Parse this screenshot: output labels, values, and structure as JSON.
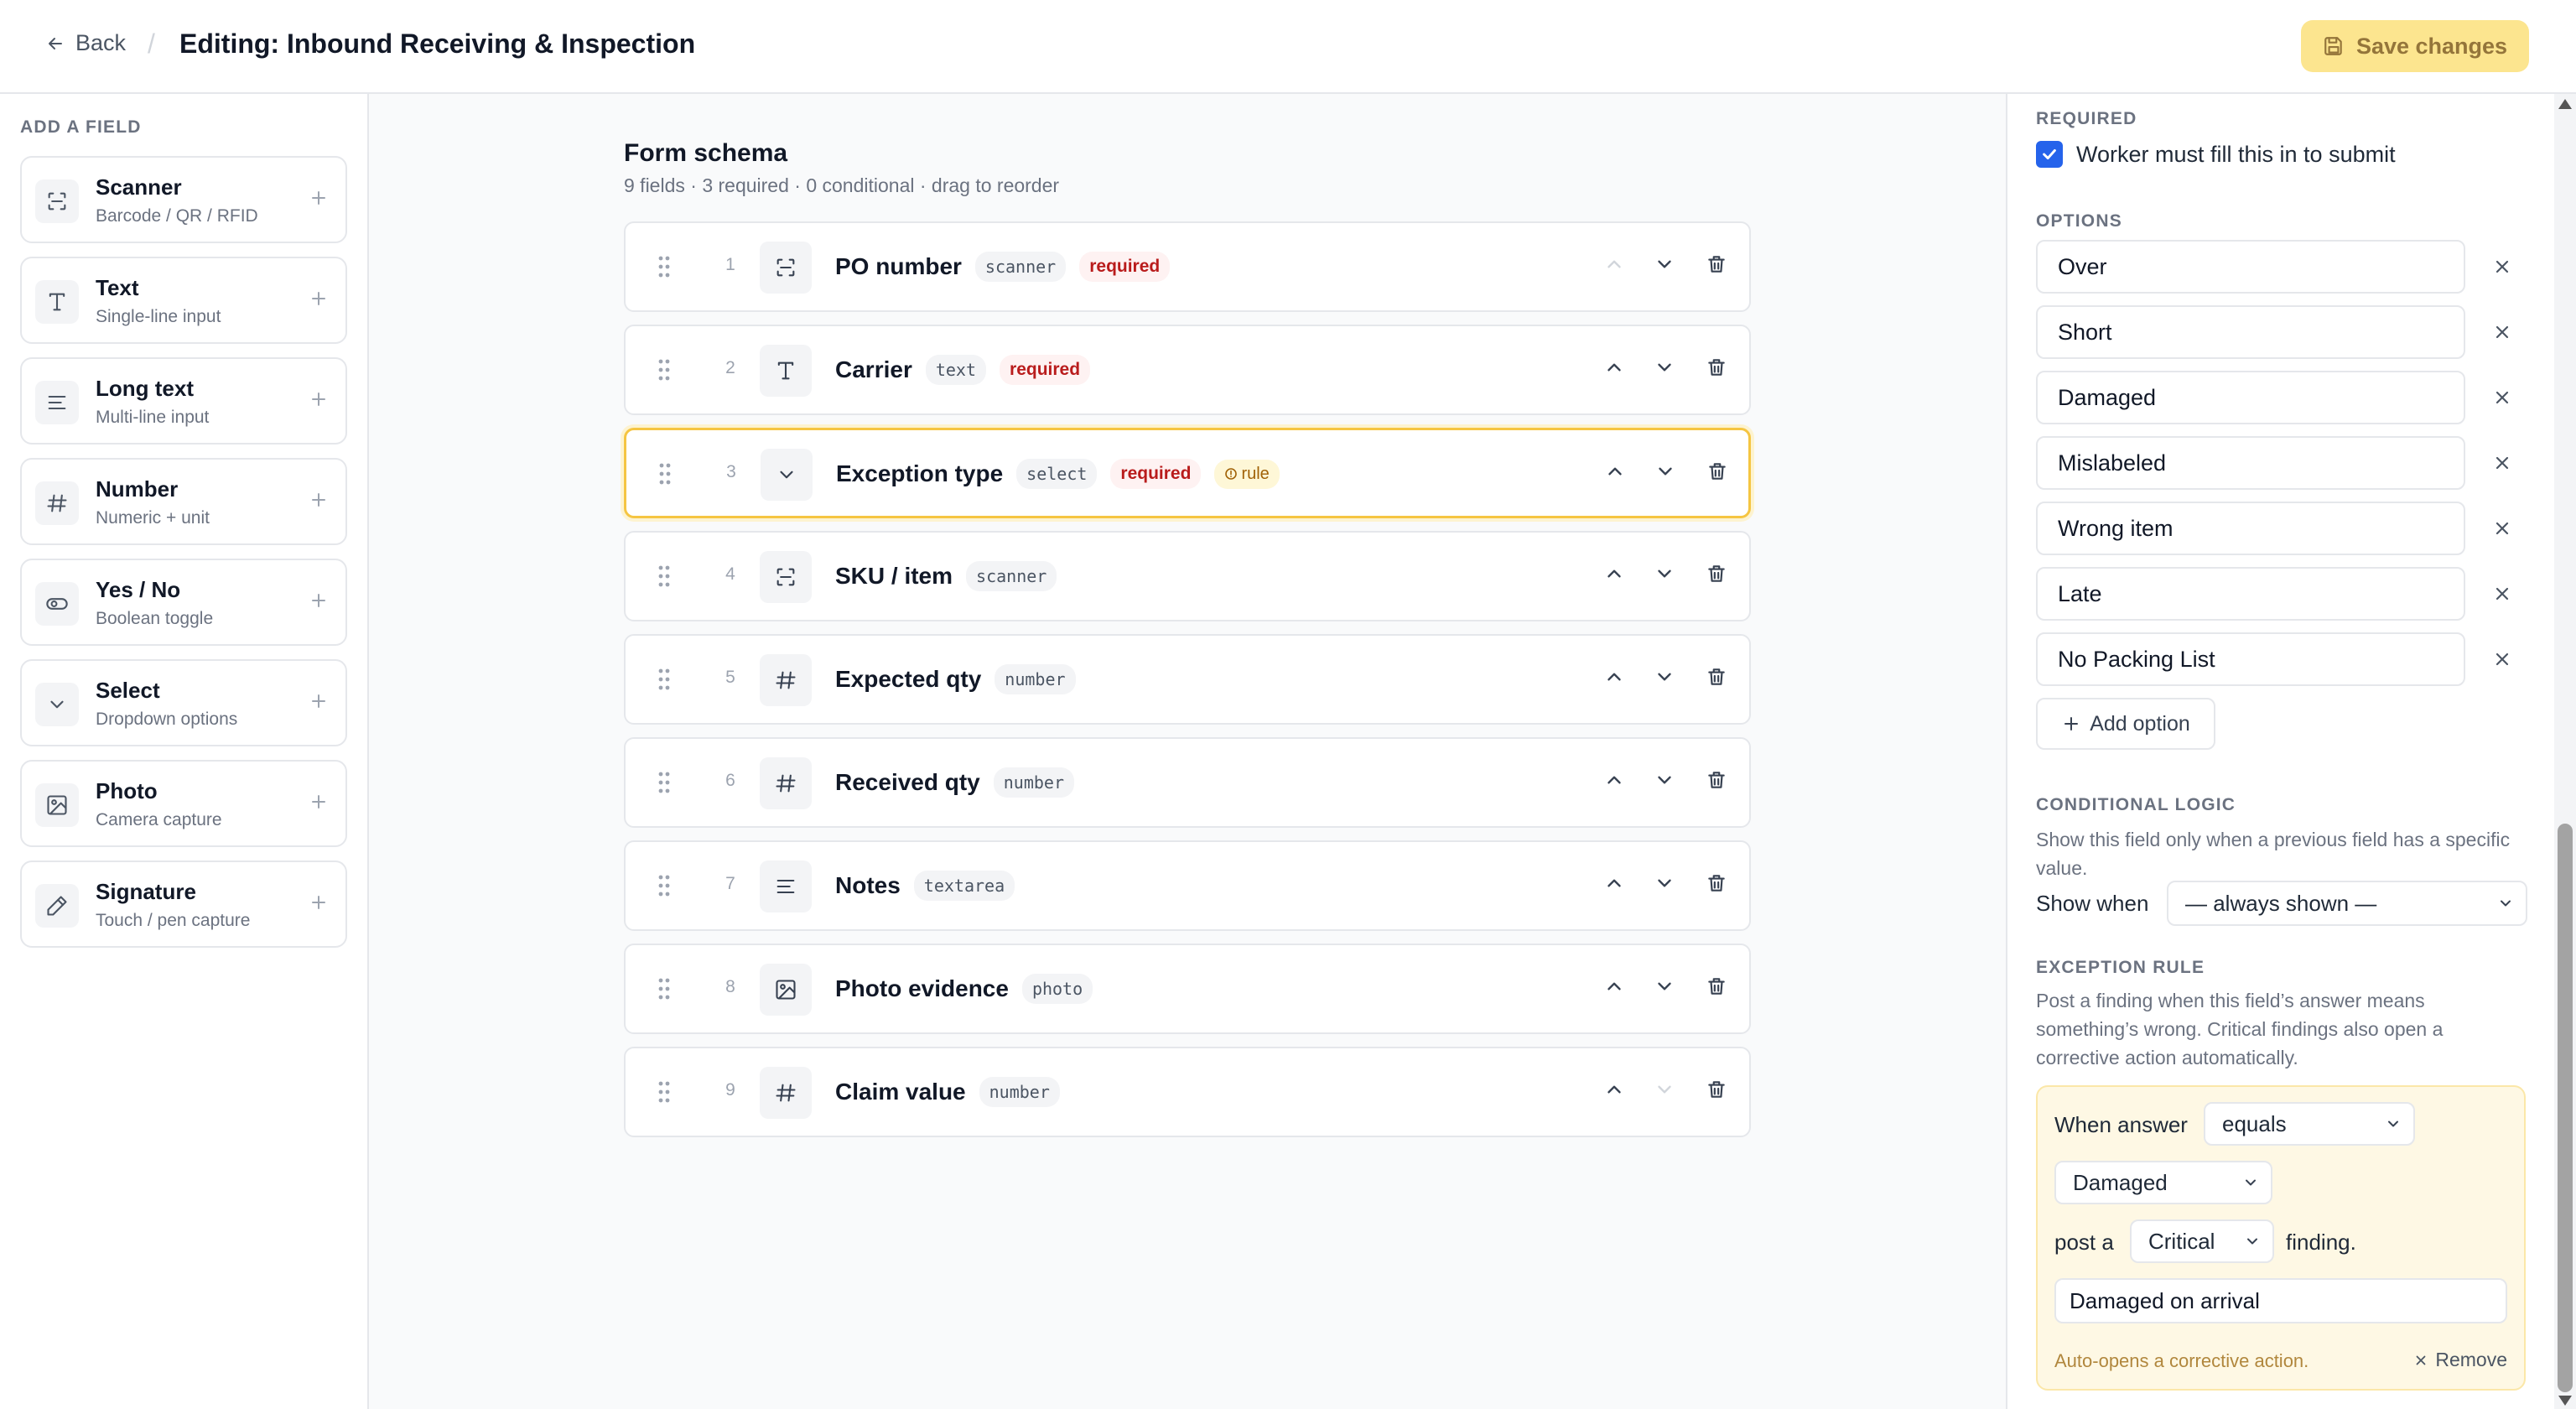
{
  "header": {
    "back_label": "Back",
    "separator": "/",
    "title": "Editing: Inbound Receiving & Inspection",
    "save_label": "Save changes"
  },
  "palette": {
    "heading": "ADD A FIELD",
    "items": [
      {
        "name": "Scanner",
        "desc": "Barcode / QR / RFID",
        "icon": "scan-icon"
      },
      {
        "name": "Text",
        "desc": "Single-line input",
        "icon": "text-icon"
      },
      {
        "name": "Long text",
        "desc": "Multi-line input",
        "icon": "lines-icon"
      },
      {
        "name": "Number",
        "desc": "Numeric + unit",
        "icon": "hash-icon"
      },
      {
        "name": "Yes / No",
        "desc": "Boolean toggle",
        "icon": "toggle-icon"
      },
      {
        "name": "Select",
        "desc": "Dropdown options",
        "icon": "chevron-down-icon"
      },
      {
        "name": "Photo",
        "desc": "Camera capture",
        "icon": "image-icon"
      },
      {
        "name": "Signature",
        "desc": "Touch / pen capture",
        "icon": "pen-icon"
      }
    ]
  },
  "schema": {
    "title": "Form schema",
    "subtitle": "9 fields · 3 required · 0 conditional · drag to reorder",
    "required_label": "required",
    "rule_label": "rule",
    "fields": [
      {
        "num": "1",
        "name": "PO number",
        "type": "scanner",
        "required": true,
        "rule": false,
        "icon": "scan-icon"
      },
      {
        "num": "2",
        "name": "Carrier",
        "type": "text",
        "required": true,
        "rule": false,
        "icon": "text-icon"
      },
      {
        "num": "3",
        "name": "Exception type",
        "type": "select",
        "required": true,
        "rule": true,
        "icon": "chevron-down-icon",
        "selected": true
      },
      {
        "num": "4",
        "name": "SKU / item",
        "type": "scanner",
        "required": false,
        "rule": false,
        "icon": "scan-icon"
      },
      {
        "num": "5",
        "name": "Expected qty",
        "type": "number",
        "required": false,
        "rule": false,
        "icon": "hash-icon"
      },
      {
        "num": "6",
        "name": "Received qty",
        "type": "number",
        "required": false,
        "rule": false,
        "icon": "hash-icon"
      },
      {
        "num": "7",
        "name": "Notes",
        "type": "textarea",
        "required": false,
        "rule": false,
        "icon": "lines-icon"
      },
      {
        "num": "8",
        "name": "Photo evidence",
        "type": "photo",
        "required": false,
        "rule": false,
        "icon": "image-icon"
      },
      {
        "num": "9",
        "name": "Claim value",
        "type": "number",
        "required": false,
        "rule": false,
        "icon": "hash-icon"
      }
    ]
  },
  "panel": {
    "required_heading": "REQUIRED",
    "required_checked": true,
    "required_text": "Worker must fill this in to submit",
    "options_heading": "OPTIONS",
    "options": [
      "Over",
      "Short",
      "Damaged",
      "Mislabeled",
      "Wrong item",
      "Late",
      "No Packing List"
    ],
    "add_option_label": "Add option",
    "conditional_heading": "CONDITIONAL LOGIC",
    "conditional_help": "Show this field only when a previous field has a specific value.",
    "show_when_label": "Show when",
    "show_when_value": "— always shown —",
    "exception_heading": "EXCEPTION RULE",
    "exception_help": "Post a finding when this field’s answer means something’s wrong. Critical findings also open a corrective action automatically.",
    "rule": {
      "when_label": "When answer",
      "operator": "equals",
      "value": "Damaged",
      "post_label": "post a",
      "severity": "Critical",
      "finding_label": "finding.",
      "finding_title": "Damaged on arrival",
      "footer": "Auto-opens a corrective action.",
      "remove_label": "Remove"
    }
  },
  "colors": {
    "accent": "#2563eb",
    "save_bg": "#fce58f",
    "selected_border": "#f5c542",
    "required_text": "#b91c1c",
    "rule_bg": "#fef8e4"
  }
}
